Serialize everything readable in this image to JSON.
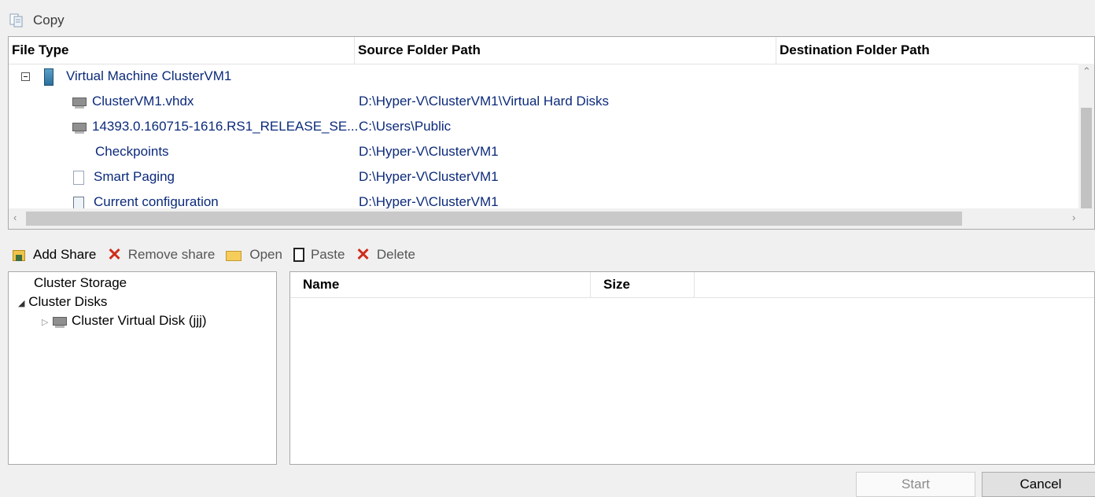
{
  "copy_toolbar": {
    "label": "Copy",
    "icon": "copy-icon"
  },
  "top_list": {
    "columns": [
      "File Type",
      "Source Folder Path",
      "Destination Folder Path"
    ],
    "rows": [
      {
        "name": "Virtual Machine ClusterVM1",
        "source": "",
        "icon": "vm-icon"
      },
      {
        "name": "ClusterVM1.vhdx",
        "source": "D:\\Hyper-V\\ClusterVM1\\Virtual Hard Disks",
        "icon": "disk-icon"
      },
      {
        "name": "14393.0.160715-1616.RS1_RELEASE_SE...",
        "source": "C:\\Users\\Public",
        "icon": "disk-icon"
      },
      {
        "name": "Checkpoints",
        "source": "D:\\Hyper-V\\ClusterVM1",
        "icon": ""
      },
      {
        "name": "Smart Paging",
        "source": "D:\\Hyper-V\\ClusterVM1",
        "icon": "document-icon"
      },
      {
        "name": "Current configuration",
        "source": "D:\\Hyper-V\\ClusterVM1",
        "icon": "config-icon"
      }
    ]
  },
  "mid_toolbar": {
    "add_share": "Add Share",
    "remove_share": "Remove share",
    "open": "Open",
    "paste": "Paste",
    "delete": "Delete"
  },
  "tree": {
    "items": [
      {
        "label": "Cluster Storage"
      },
      {
        "label": "Cluster Disks"
      },
      {
        "label": "Cluster Virtual Disk (jjj)"
      }
    ]
  },
  "right_list": {
    "columns": [
      "Name",
      "Size"
    ]
  },
  "buttons": {
    "start": "Start",
    "cancel": "Cancel"
  }
}
